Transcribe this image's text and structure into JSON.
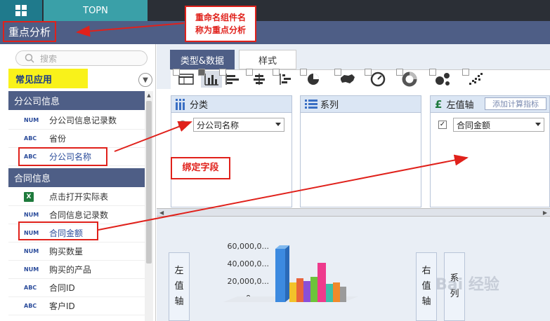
{
  "topbar": {
    "tab_label": "TOPN"
  },
  "page": {
    "title": "重点分析"
  },
  "callouts": {
    "rename_note": "重命名组件名\n称为重点分析",
    "bind_note": "绑定字段"
  },
  "left": {
    "search_placeholder": "搜索",
    "common_label": "常见应用",
    "groups": [
      {
        "title": "分公司信息",
        "fields": [
          {
            "tag": "NUM",
            "name": "分公司信息记录数"
          },
          {
            "tag": "ABC",
            "name": "省份"
          },
          {
            "tag": "ABC",
            "name": "分公司名称"
          }
        ]
      },
      {
        "title": "合同信息",
        "fields": [
          {
            "tag": "excel-icon",
            "name": "点击打开实际表"
          },
          {
            "tag": "NUM",
            "name": "合同信息记录数"
          },
          {
            "tag": "NUM",
            "name": "合同金额"
          },
          {
            "tag": "NUM",
            "name": "购买数量"
          },
          {
            "tag": "NUM",
            "name": "购买的产品"
          },
          {
            "tag": "ABC",
            "name": "合同ID"
          },
          {
            "tag": "ABC",
            "name": "客户ID"
          }
        ]
      }
    ]
  },
  "tabs": {
    "type_data": "类型&数据",
    "style": "样式"
  },
  "boxes": {
    "category": {
      "title": "分类",
      "select_value": "分公司名称"
    },
    "series": {
      "title": "系列"
    },
    "left_axis": {
      "title": "左值轴",
      "add_calc": "添加计算指标",
      "select_value": "合同金额"
    }
  },
  "preview": {
    "left_axis_label": [
      "左",
      "值",
      "轴"
    ],
    "right_axis_label": [
      "右",
      "值",
      "轴"
    ],
    "series_label": [
      "系",
      "列"
    ],
    "y_ticks": [
      "60,000,0...",
      "40,000,0...",
      "20,000,0...",
      "0"
    ]
  },
  "watermark": "Bai 经验",
  "colors": {
    "accent": "#4e5e86",
    "highlight": "#f9f21a",
    "annotation": "#e0211b",
    "teal": "#3aa0a8"
  }
}
